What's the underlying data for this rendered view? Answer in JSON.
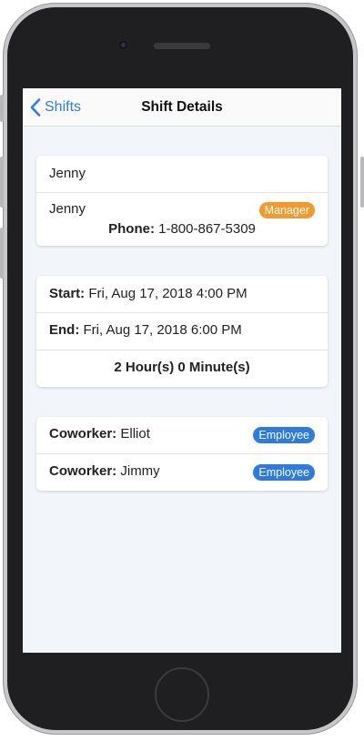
{
  "nav": {
    "back_label": "Shifts",
    "title": "Shift Details"
  },
  "manager_card": {
    "title_name": "Jenny",
    "name": "Jenny",
    "role_badge": "Manager",
    "phone_label": "Phone:",
    "phone_value": "1-800-867-5309"
  },
  "time_card": {
    "start_label": "Start:",
    "start_value": "Fri, Aug 17, 2018 4:00 PM",
    "end_label": "End:",
    "end_value": "Fri, Aug 17, 2018 6:00 PM",
    "duration": "2 Hour(s) 0 Minute(s)"
  },
  "coworkers": [
    {
      "label": "Coworker:",
      "name": "Elliot",
      "role_badge": "Employee"
    },
    {
      "label": "Coworker:",
      "name": "Jimmy",
      "role_badge": "Employee"
    }
  ],
  "colors": {
    "accent": "#2f7bf0",
    "manager_badge": "#f49a2c",
    "employee_badge": "#2c7be5",
    "screen_background": "#f2f5fa"
  },
  "icons": {
    "back": "chevron-left-icon"
  }
}
